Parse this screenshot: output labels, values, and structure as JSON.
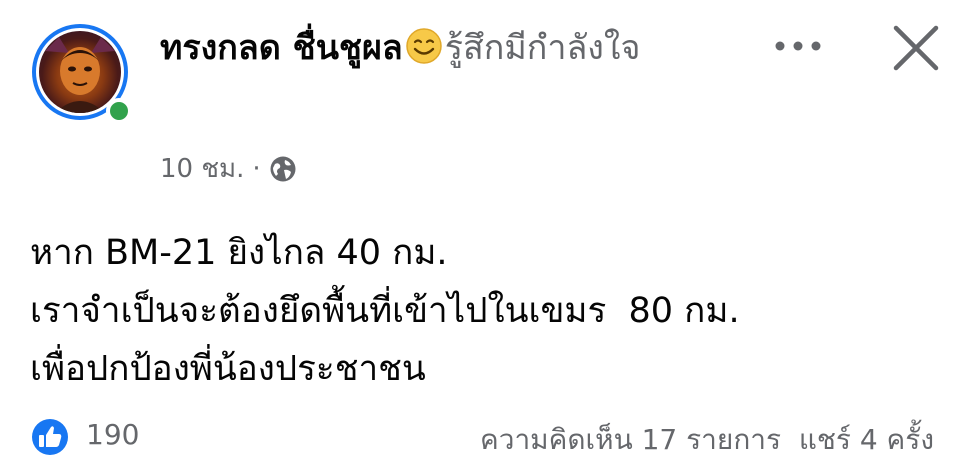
{
  "post": {
    "author_name": "ทรงกลด ชื่นชูผล",
    "feeling_text": "รู้สึกมีกำลังใจ",
    "feeling_emoji": "smiling-face-icon",
    "timestamp": "10 ชม.",
    "separator": "·",
    "privacy_icon": "globe-icon",
    "lines": [
      "หาก BM-21 ยิงไกล 40 กม.",
      "เราจำเป็นจะต้องยึดพื้นที่เข้าไปในเขมร  80 กม.",
      "เพื่อปกป้องพี่น้องประชาชน"
    ]
  },
  "header": {
    "menu_icon": "more-dots-icon",
    "close_icon": "close-icon"
  },
  "reactions": {
    "icon": "like-icon",
    "count": "190"
  },
  "stats": {
    "comments": "ความคิดเห็น 17 รายการ",
    "shares": "แชร์ 4 ครั้ง"
  },
  "colors": {
    "brand_blue": "#1877f2",
    "online_green": "#31a24c",
    "secondary_text": "#65676b",
    "emoji_yellow": "#f7c948"
  }
}
